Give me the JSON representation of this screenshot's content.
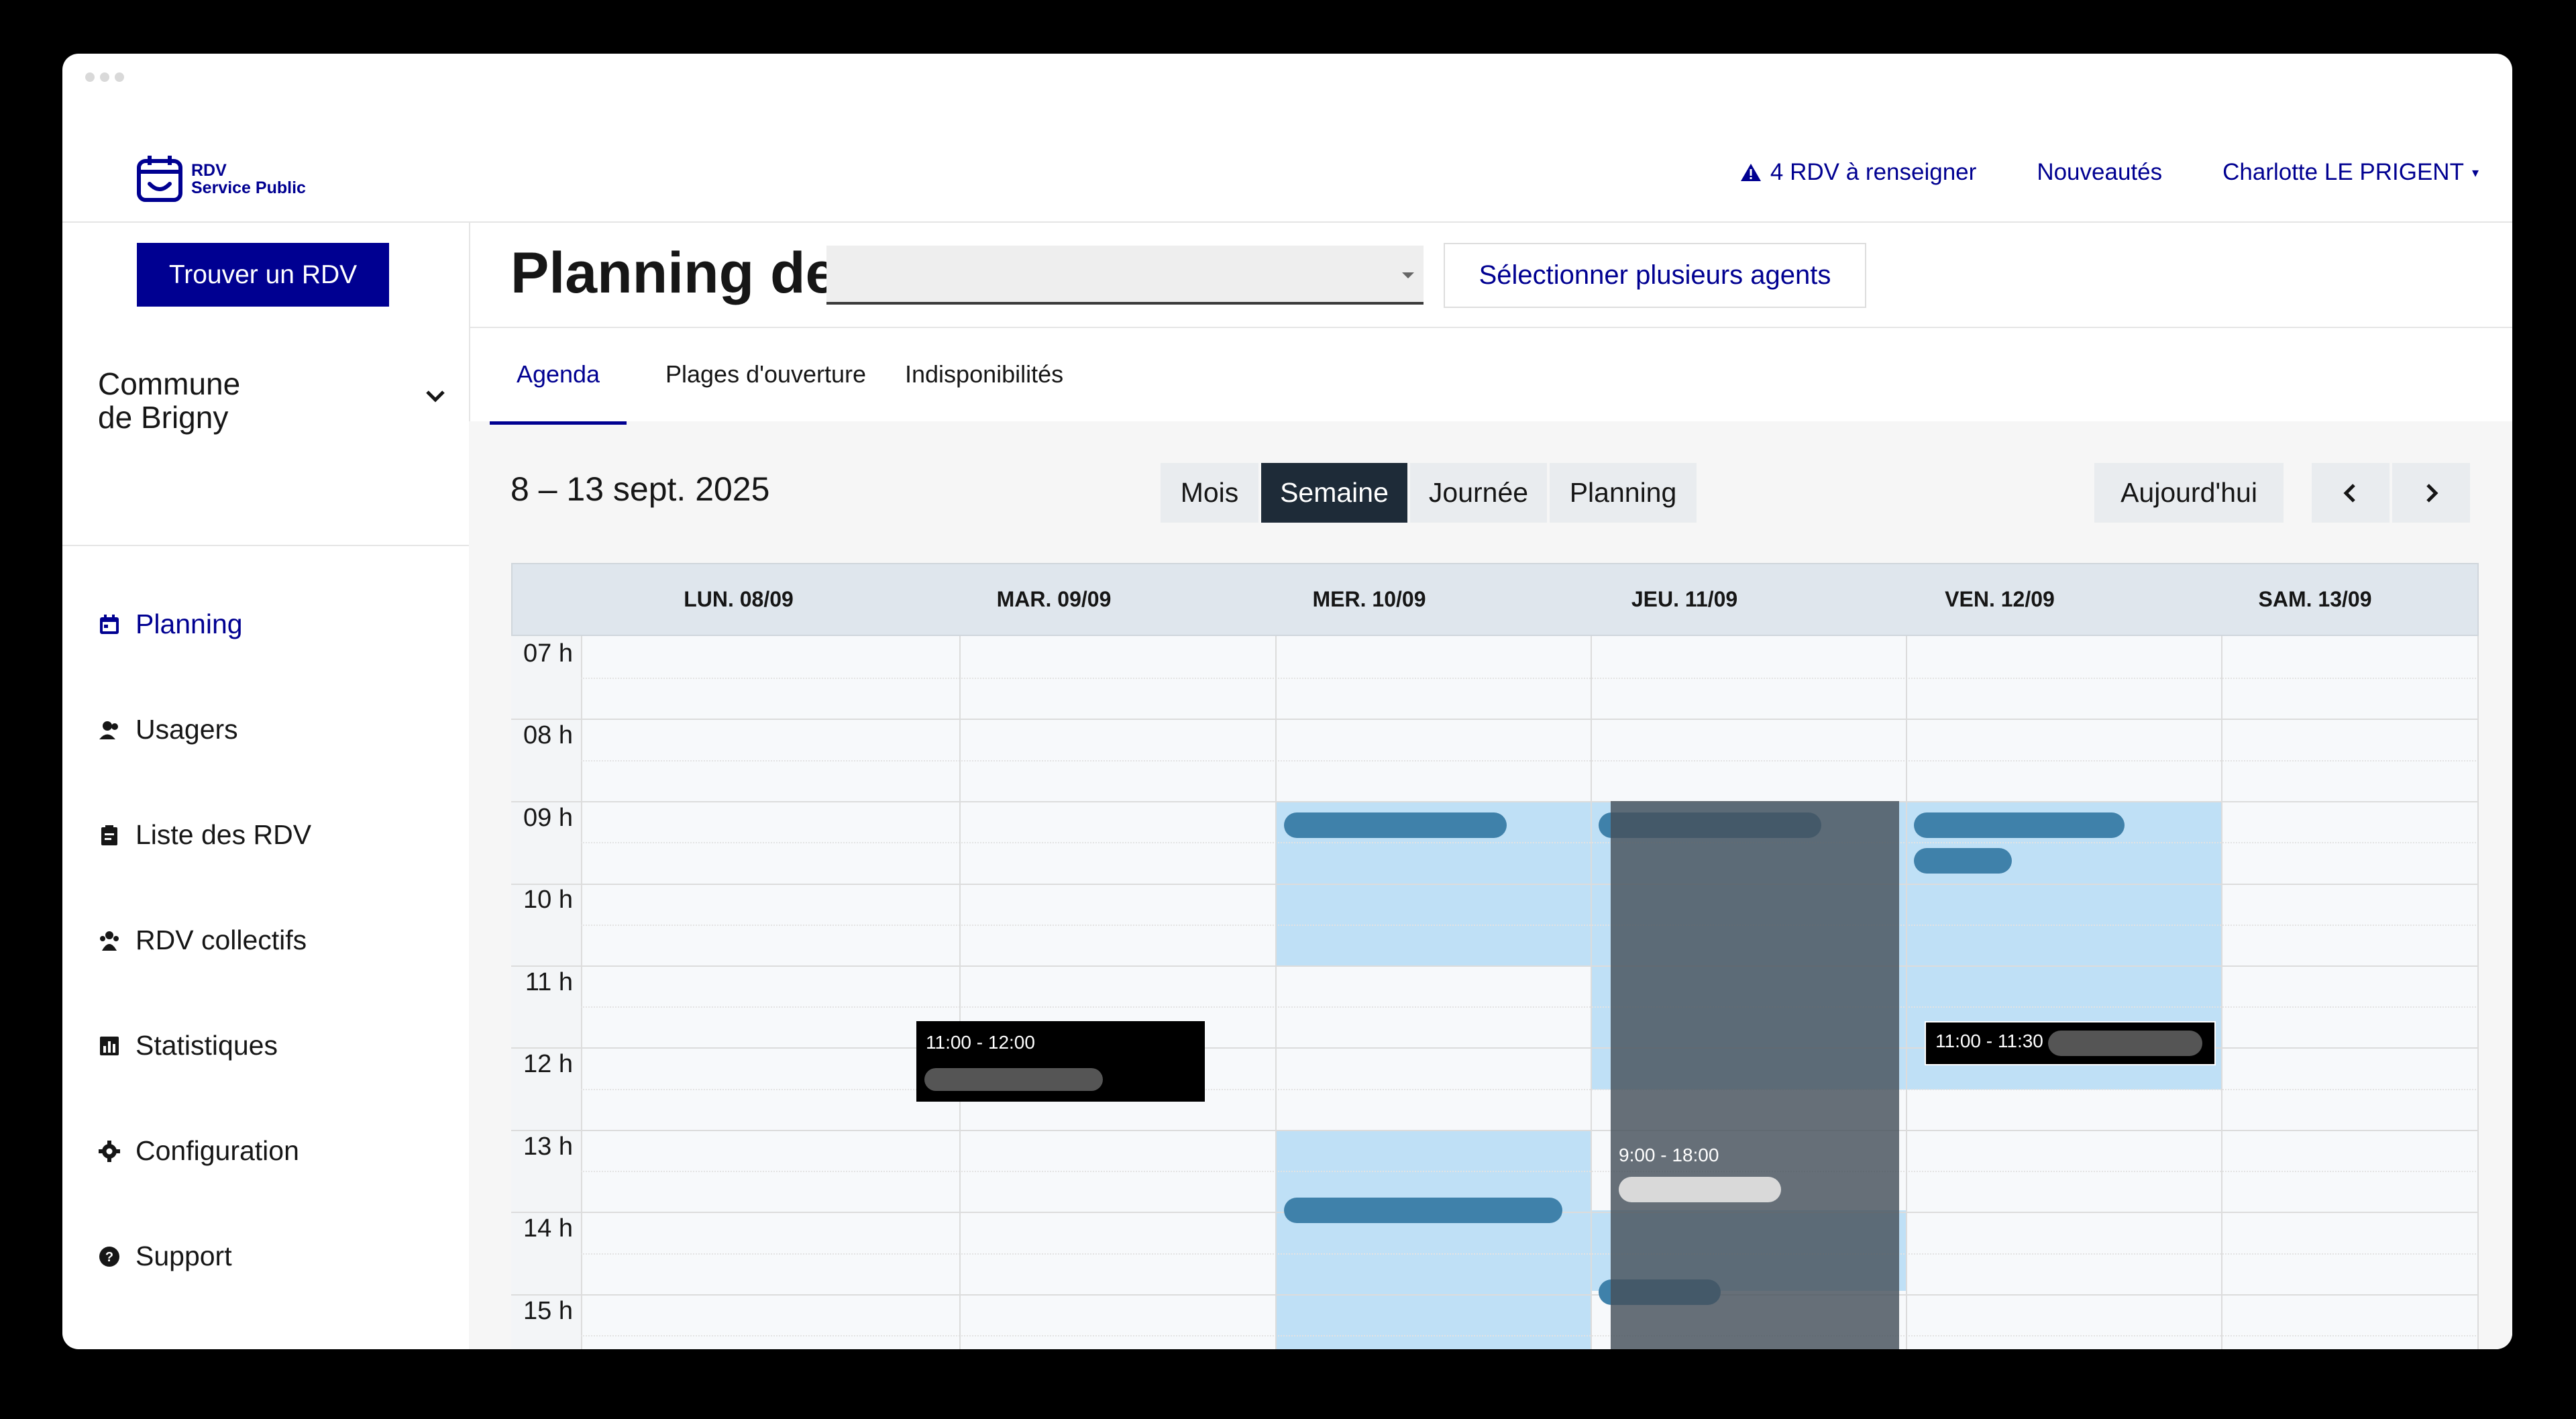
{
  "header": {
    "logo_line1": "RDV",
    "logo_line2": "Service Public",
    "alert_label": "4 RDV à renseigner",
    "news_label": "Nouveautés",
    "user_name": "Charlotte LE PRIGENT"
  },
  "sidebar": {
    "find_button": "Trouver un RDV",
    "org_line1": "Commune",
    "org_line2": "de Brigny",
    "items": [
      {
        "label": "Planning",
        "icon": "calendar-icon"
      },
      {
        "label": "Usagers",
        "icon": "users-icon"
      },
      {
        "label": "Liste des RDV",
        "icon": "clipboard-icon"
      },
      {
        "label": "RDV collectifs",
        "icon": "group-icon"
      },
      {
        "label": "Statistiques",
        "icon": "chart-icon"
      },
      {
        "label": "Configuration",
        "icon": "gear-icon"
      },
      {
        "label": "Support",
        "icon": "help-icon"
      }
    ]
  },
  "main": {
    "title": "Planning de",
    "select_value": "",
    "multi_agents_button": "Sélectionner plusieurs agents",
    "tabs": [
      {
        "label": "Agenda"
      },
      {
        "label": "Plages d'ouverture"
      },
      {
        "label": "Indisponibilités"
      }
    ],
    "date_range": "8 – 13 sept. 2025",
    "views": [
      "Mois",
      "Semaine",
      "Journée",
      "Planning"
    ],
    "active_view": "Semaine",
    "today_button": "Aujourd'hui"
  },
  "calendar": {
    "days": [
      "LUN. 08/09",
      "MAR. 09/09",
      "MER. 10/09",
      "JEU. 11/09",
      "VEN. 12/09",
      "SAM. 13/09"
    ],
    "hours": [
      "07 h",
      "08 h",
      "09 h",
      "10 h",
      "11 h",
      "12 h",
      "13 h",
      "14 h",
      "15 h"
    ],
    "events": {
      "tue_time": "11:00 - 12:00",
      "fri_time": "11:00 - 11:30 -",
      "thu_absence_time": "9:00 - 18:00"
    }
  },
  "colors": {
    "brand": "#000091",
    "slot_blue": "#bfe0f6",
    "event_blue": "#3f81aa",
    "active_view": "#1e2b38"
  }
}
